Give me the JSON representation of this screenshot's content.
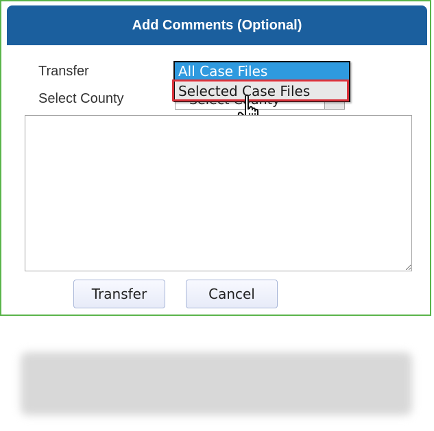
{
  "dialog": {
    "title": "Add Comments (Optional)",
    "transfer_label": "Transfer",
    "county_label": "Select County",
    "county_select_value": "Select County",
    "transfer_options": [
      "All Case Files",
      "Selected Case Files"
    ],
    "selected_option_index": 0,
    "hovered_option_index": 1,
    "comment_value": "",
    "buttons": {
      "transfer": "Transfer",
      "cancel": "Cancel"
    }
  },
  "colors": {
    "header_bg": "#1b5f9e",
    "frame_border": "#5ab44a",
    "option_selected_bg": "#2f9adf",
    "highlight_border": "#d9323b"
  },
  "icons": {
    "cursor": "hand-pointer-icon",
    "dropdown_arrow": "chevron-down-icon"
  }
}
